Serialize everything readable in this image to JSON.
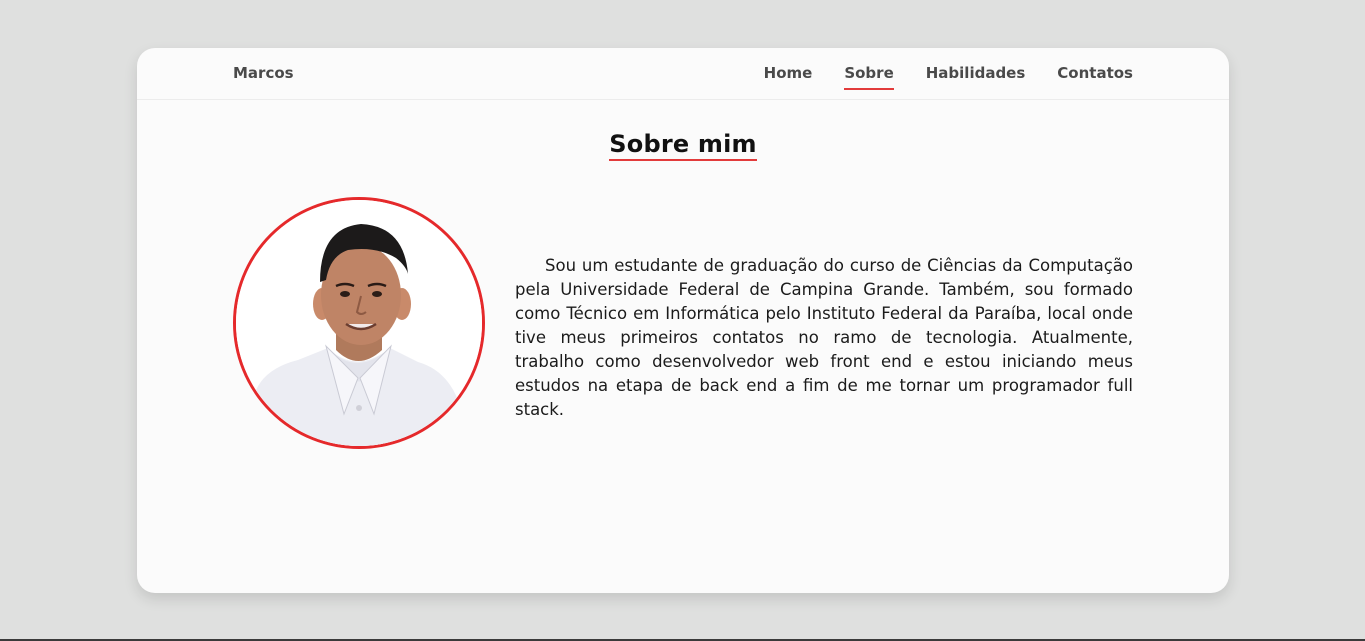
{
  "navbar": {
    "brand": "Marcos",
    "links": [
      {
        "label": "Home",
        "active": false
      },
      {
        "label": "Sobre",
        "active": true
      },
      {
        "label": "Habilidades",
        "active": false
      },
      {
        "label": "Contatos",
        "active": false
      }
    ]
  },
  "about": {
    "title": "Sobre mim",
    "text": "Sou um estudante de graduação do curso de Ciências da Computação pela Universidade Federal de Campina Grande. Também, sou formado como Técnico em Informática pelo Instituto Federal da Paraíba, local onde tive meus primeiros contatos no ramo de tecnologia. Atualmente, trabalho como desenvolvedor web front end e estou iniciando meus estudos na etapa de back end a fim de me tornar um programador full stack."
  },
  "colors": {
    "accent": "#e5292b",
    "page_background": "#dfe0df",
    "card_background": "#fbfbfb",
    "nav_text": "#4a4a4a"
  }
}
